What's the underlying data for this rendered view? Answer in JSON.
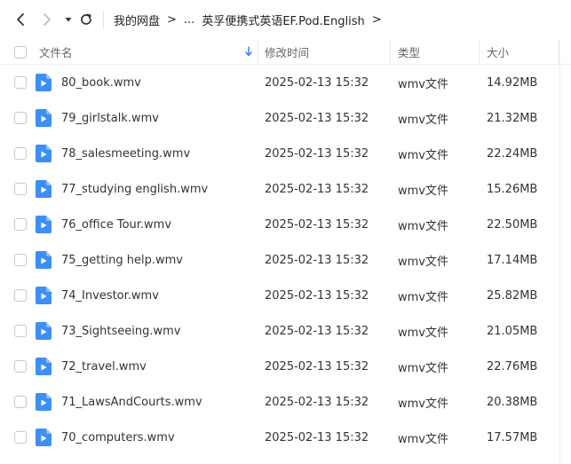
{
  "breadcrumb": {
    "root": "我的网盘",
    "ellipsis": "...",
    "current": "英孚便携式英语EF.Pod.English"
  },
  "table": {
    "headers": {
      "name": "文件名",
      "modified": "修改时间",
      "type": "类型",
      "size": "大小"
    },
    "rows": [
      {
        "name": "80_book.wmv",
        "modified": "2025-02-13 15:32",
        "type": "wmv文件",
        "size": "14.92MB"
      },
      {
        "name": "79_girlstalk.wmv",
        "modified": "2025-02-13 15:32",
        "type": "wmv文件",
        "size": "21.32MB"
      },
      {
        "name": "78_salesmeeting.wmv",
        "modified": "2025-02-13 15:32",
        "type": "wmv文件",
        "size": "22.24MB"
      },
      {
        "name": "77_studying english.wmv",
        "modified": "2025-02-13 15:32",
        "type": "wmv文件",
        "size": "15.26MB"
      },
      {
        "name": "76_office Tour.wmv",
        "modified": "2025-02-13 15:32",
        "type": "wmv文件",
        "size": "22.50MB"
      },
      {
        "name": "75_getting help.wmv",
        "modified": "2025-02-13 15:32",
        "type": "wmv文件",
        "size": "17.14MB"
      },
      {
        "name": "74_Investor.wmv",
        "modified": "2025-02-13 15:32",
        "type": "wmv文件",
        "size": "25.82MB"
      },
      {
        "name": "73_Sightseeing.wmv",
        "modified": "2025-02-13 15:32",
        "type": "wmv文件",
        "size": "21.05MB"
      },
      {
        "name": "72_travel.wmv",
        "modified": "2025-02-13 15:32",
        "type": "wmv文件",
        "size": "22.76MB"
      },
      {
        "name": "71_LawsAndCourts.wmv",
        "modified": "2025-02-13 15:32",
        "type": "wmv文件",
        "size": "20.38MB"
      },
      {
        "name": "70_computers.wmv",
        "modified": "2025-02-13 15:32",
        "type": "wmv文件",
        "size": "17.57MB"
      }
    ]
  },
  "icons": {
    "back": "chevron-left-icon",
    "forward": "chevron-right-icon",
    "history": "caret-down-icon",
    "refresh": "refresh-icon",
    "sort": "sort-down-arrow-icon",
    "file": "video-file-icon"
  },
  "colors": {
    "accent": "#3b8cf5",
    "file_icon": "#3d8ff6"
  }
}
